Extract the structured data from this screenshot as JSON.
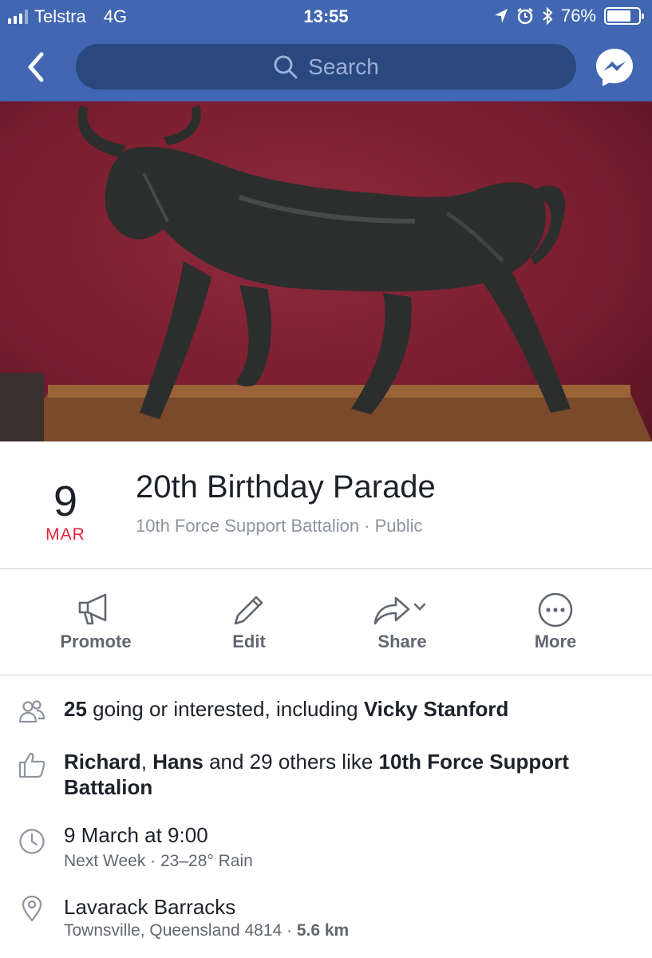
{
  "status_bar": {
    "carrier": "Telstra",
    "network": "4G",
    "time": "13:55",
    "battery_percent": "76%",
    "battery_level": 0.76
  },
  "nav": {
    "search_placeholder": "Search"
  },
  "event": {
    "day": "9",
    "month": "MAR",
    "title": "20th Birthday Parade",
    "subtitle": "10th Force Support Battalion · Public"
  },
  "actions": [
    {
      "label": "Promote",
      "icon": "megaphone-icon"
    },
    {
      "label": "Edit",
      "icon": "pencil-icon"
    },
    {
      "label": "Share",
      "icon": "share-arrow-icon"
    },
    {
      "label": "More",
      "icon": "more-dots-icon"
    }
  ],
  "info": {
    "going": {
      "count": "25",
      "text_mid": " going or interested, including ",
      "name": "Vicky Stanford"
    },
    "likes": {
      "name1": "Richard",
      "sep": ", ",
      "name2": "Hans",
      "text_mid": " and 29 others like ",
      "page": "10th Force Support Battalion"
    },
    "time": {
      "line1": "9 March at 9:00",
      "line2": "Next Week · 23–28° Rain"
    },
    "location": {
      "line1": "Lavarack Barracks",
      "line2": "Townsville, Queensland 4814 · ",
      "distance": "5.6 km"
    }
  },
  "colors": {
    "nav_blue": "#4267b2",
    "search_bg": "#29487d",
    "month_red": "#e0243a"
  }
}
